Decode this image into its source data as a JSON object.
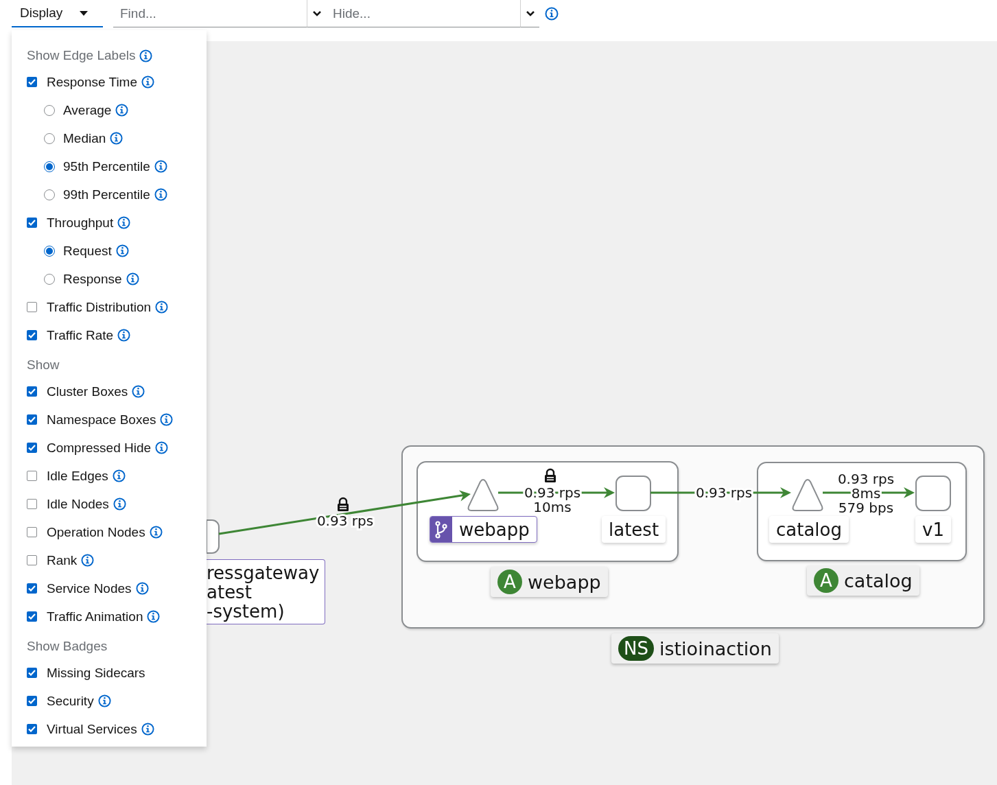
{
  "toolbar": {
    "display_button": "Display",
    "find": {
      "placeholder": "Find..."
    },
    "hide": {
      "placeholder": "Hide..."
    }
  },
  "menu": {
    "items": [
      {
        "kind": "heading",
        "label": "Show Edge Labels",
        "info": true
      },
      {
        "kind": "checkbox",
        "label": "Response Time",
        "checked": true,
        "info": true
      },
      {
        "kind": "radio",
        "label": "Average",
        "selected": false,
        "info": true
      },
      {
        "kind": "radio",
        "label": "Median",
        "selected": false,
        "info": true
      },
      {
        "kind": "radio",
        "label": "95th Percentile",
        "selected": true,
        "info": true
      },
      {
        "kind": "radio",
        "label": "99th Percentile",
        "selected": false,
        "info": true
      },
      {
        "kind": "checkbox",
        "label": "Throughput",
        "checked": true,
        "info": true
      },
      {
        "kind": "radio",
        "label": "Request",
        "selected": true,
        "info": true
      },
      {
        "kind": "radio",
        "label": "Response",
        "selected": false,
        "info": true
      },
      {
        "kind": "checkbox",
        "label": "Traffic Distribution",
        "checked": false,
        "info": true
      },
      {
        "kind": "checkbox",
        "label": "Traffic Rate",
        "checked": true,
        "info": true
      },
      {
        "kind": "heading",
        "label": "Show",
        "info": false
      },
      {
        "kind": "checkbox",
        "label": "Cluster Boxes",
        "checked": true,
        "info": true
      },
      {
        "kind": "checkbox",
        "label": "Namespace Boxes",
        "checked": true,
        "info": true
      },
      {
        "kind": "checkbox",
        "label": "Compressed Hide",
        "checked": true,
        "info": true
      },
      {
        "kind": "checkbox",
        "label": "Idle Edges",
        "checked": false,
        "info": true
      },
      {
        "kind": "checkbox",
        "label": "Idle Nodes",
        "checked": false,
        "info": true
      },
      {
        "kind": "checkbox",
        "label": "Operation Nodes",
        "checked": false,
        "info": true
      },
      {
        "kind": "checkbox",
        "label": "Rank",
        "checked": false,
        "info": true
      },
      {
        "kind": "checkbox",
        "label": "Service Nodes",
        "checked": true,
        "info": true
      },
      {
        "kind": "checkbox",
        "label": "Traffic Animation",
        "checked": true,
        "info": true
      },
      {
        "kind": "heading",
        "label": "Show Badges",
        "info": false
      },
      {
        "kind": "checkbox",
        "label": "Missing Sidecars",
        "checked": true,
        "info": false
      },
      {
        "kind": "checkbox",
        "label": "Security",
        "checked": true,
        "info": true
      },
      {
        "kind": "checkbox",
        "label": "Virtual Services",
        "checked": true,
        "info": true
      }
    ]
  },
  "graph": {
    "namespace": {
      "badge": "NS",
      "label": "istioinaction"
    },
    "apps": [
      {
        "badge": "A",
        "label": "webapp"
      },
      {
        "badge": "A",
        "label": "catalog"
      }
    ],
    "nodes": [
      {
        "kind": "service",
        "label": "webapp",
        "virtual_service": true
      },
      {
        "kind": "workload",
        "label": "latest",
        "virtual_service": false
      },
      {
        "kind": "service",
        "label": "catalog",
        "virtual_service": false
      },
      {
        "kind": "workload",
        "label": "v1",
        "virtual_service": false
      }
    ],
    "ingress": {
      "lines": [
        "ressgateway",
        "atest",
        "-system)"
      ]
    },
    "edges": [
      {
        "labels": [
          "0.93 rps"
        ],
        "secure": true
      },
      {
        "labels": [
          "0.93 rps",
          "10ms"
        ],
        "secure": true
      },
      {
        "labels": [
          "0.93 rps"
        ],
        "secure": false
      },
      {
        "labels": [
          "0.93 rps",
          "8ms",
          "579 bps"
        ],
        "secure": false
      }
    ]
  }
}
